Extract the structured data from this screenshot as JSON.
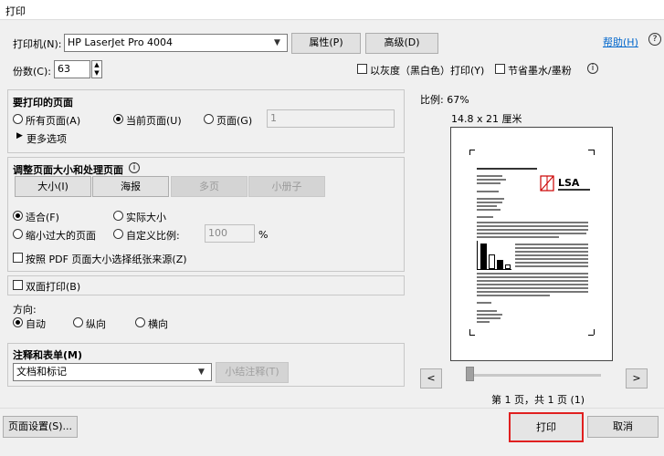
{
  "window": {
    "title": "打印"
  },
  "printer": {
    "label": "打印机(N):",
    "value": "HP LaserJet Pro 4004",
    "properties": "属性(P)",
    "advanced": "高级(D)"
  },
  "help": "帮助(H)",
  "copies": {
    "label": "份数(C):",
    "value": "63"
  },
  "grayscale": {
    "label": "以灰度（黑白色）打印(Y)",
    "checked": false
  },
  "save_ink": {
    "label": "节省墨水/墨粉",
    "checked": false
  },
  "pages": {
    "title": "要打印的页面",
    "all": "所有页面(A)",
    "current": "当前页面(U)",
    "range": "页面(G)",
    "range_value": "1",
    "more": "更多选项",
    "selected": "current"
  },
  "sizing": {
    "title": "调整页面大小和处理页面",
    "tabs": [
      "大小(I)",
      "海报",
      "多页",
      "小册子"
    ],
    "fit": "适合(F)",
    "actual": "实际大小",
    "shrink": "缩小过大的页面",
    "custom": "自定义比例:",
    "custom_value": "100",
    "percent": "%",
    "choose_paper": "按照 PDF 页面大小选择纸张来源(Z)",
    "selected": "fit"
  },
  "duplex": {
    "label": "双面打印(B)",
    "checked": false
  },
  "orientation": {
    "title": "方向:",
    "auto": "自动",
    "portrait": "纵向",
    "landscape": "横向",
    "selected": "auto"
  },
  "comments": {
    "title": "注释和表单(M)",
    "value": "文档和标记",
    "summarize": "小结注释(T)"
  },
  "preview": {
    "scale": "比例:   67%",
    "size": "14.8 x 21 厘米",
    "page_info": "第 1 页，共 1 页 (1)",
    "prev": "<",
    "next": ">",
    "logo_text": "LSA"
  },
  "footer": {
    "page_setup": "页面设置(S)...",
    "print": "打印",
    "cancel": "取消"
  }
}
